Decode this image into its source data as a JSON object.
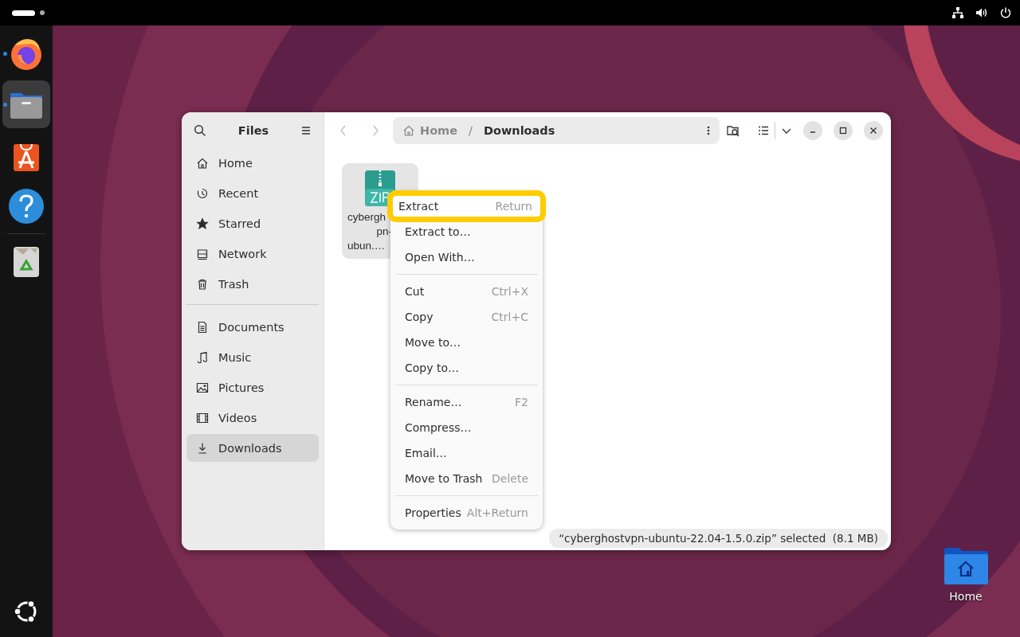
{
  "top_bar": {
    "workspaces": [
      {
        "selected": true
      },
      {
        "selected": false
      }
    ]
  },
  "dock": {
    "apps": [
      {
        "kind": "firefox",
        "running": true,
        "selected": false
      },
      {
        "kind": "files",
        "running": true,
        "selected": true
      },
      {
        "kind": "app-center",
        "running": false,
        "selected": false
      },
      {
        "kind": "help",
        "running": false,
        "selected": false
      },
      {
        "kind": "trash",
        "running": false,
        "selected": false
      }
    ]
  },
  "window": {
    "sidebar": {
      "title": "Files",
      "places": [
        {
          "kind": "home",
          "label": "Home",
          "selected": false
        },
        {
          "kind": "recent",
          "label": "Recent",
          "selected": false
        },
        {
          "kind": "starred",
          "label": "Starred",
          "selected": false
        },
        {
          "kind": "network",
          "label": "Network",
          "selected": false
        },
        {
          "kind": "trash",
          "label": "Trash",
          "selected": false
        }
      ],
      "bookmarks": [
        {
          "kind": "documents",
          "label": "Documents",
          "selected": false
        },
        {
          "kind": "music",
          "label": "Music",
          "selected": false
        },
        {
          "kind": "pictures",
          "label": "Pictures",
          "selected": false
        },
        {
          "kind": "videos",
          "label": "Videos",
          "selected": false
        },
        {
          "kind": "downloads",
          "label": "Downloads",
          "selected": true
        }
      ]
    },
    "path": [
      {
        "label": "Home",
        "current": false
      },
      {
        "label": "Downloads",
        "current": true
      }
    ],
    "path_separator": "/",
    "files": [
      {
        "name_lines": [
          "cybergh",
          "pn-",
          "ubun.…"
        ],
        "selected": true
      }
    ],
    "context_menu": {
      "groups": [
        [
          {
            "label": "Extract",
            "shortcut": "Return",
            "selected": true
          },
          {
            "label": "Extract to…",
            "selected": false
          },
          {
            "label": "Open With…",
            "selected": false
          }
        ],
        [
          {
            "label": "Cut",
            "shortcut": "Ctrl+X",
            "selected": false
          },
          {
            "label": "Copy",
            "shortcut": "Ctrl+C",
            "selected": false
          },
          {
            "label": "Move to…",
            "selected": false
          },
          {
            "label": "Copy to…",
            "selected": false
          }
        ],
        [
          {
            "label": "Rename…",
            "shortcut": "F2",
            "selected": false
          },
          {
            "label": "Compress…",
            "selected": false
          },
          {
            "label": "Email…",
            "selected": false
          },
          {
            "label": "Move to Trash",
            "shortcut": "Delete",
            "selected": false
          }
        ],
        [
          {
            "label": "Properties",
            "shortcut": "Alt+Return",
            "selected": false
          }
        ]
      ]
    },
    "status": "“cyberghostvpn-ubuntu-22.04-1.5.0.zip” selected  (8.1 MB)"
  },
  "desktop_icons": [
    {
      "label": "Home"
    }
  ]
}
